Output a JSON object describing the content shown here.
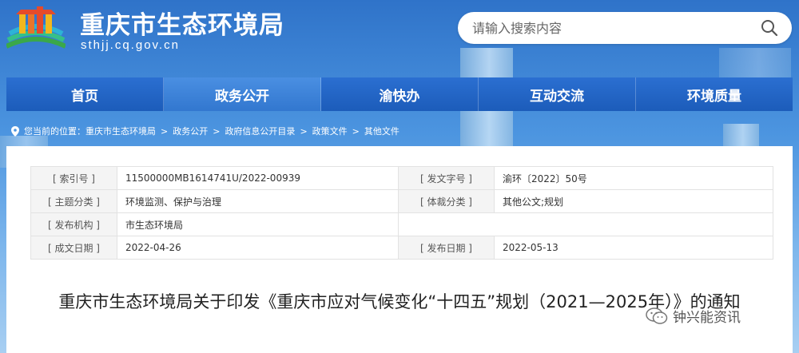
{
  "header": {
    "site_title": "重庆市生态环境局",
    "site_url": "sthjj.cq.gov.cn",
    "logo_icon": "emblem-logo-icon"
  },
  "search": {
    "placeholder": "请输入搜索内容",
    "icon": "search-icon"
  },
  "nav": {
    "items": [
      {
        "label": "首页"
      },
      {
        "label": "政务公开"
      },
      {
        "label": "渝快办"
      },
      {
        "label": "互动交流"
      },
      {
        "label": "环境质量"
      }
    ],
    "active_index": 1
  },
  "breadcrumb": {
    "prefix": "您当前的位置：",
    "items": [
      "重庆市生态环境局",
      "政务公开",
      "政府信息公开目录",
      "政策文件",
      "其他文件"
    ],
    "separator": ">"
  },
  "meta": {
    "index_label": "[ 索引号 ]",
    "index_value": "11500000MB1614741U/2022-00939",
    "doc_no_label": "[ 发文字号 ]",
    "doc_no_value": "渝环〔2022〕50号",
    "topic_label": "[ 主题分类 ]",
    "topic_value": "环境监测、保护与治理",
    "genre_label": "[ 体裁分类 ]",
    "genre_value": "其他公文;规划",
    "publisher_label": "[ 发布机构 ]",
    "publisher_value": "市生态环境局",
    "created_label": "[ 成文日期 ]",
    "created_value": "2022-04-26",
    "published_label": "[ 发布日期 ]",
    "published_value": "2022-05-13"
  },
  "document": {
    "title": "重庆市生态环境局关于印发《重庆市应对气候变化“十四五”规划（2021—2025年）》的通知"
  },
  "watermark": {
    "text": "钟兴能资讯",
    "icon": "wechat-icon"
  },
  "colors": {
    "nav_bg": "#1c5cba",
    "nav_active": "#3277cf",
    "sky": "#4c95e0"
  }
}
